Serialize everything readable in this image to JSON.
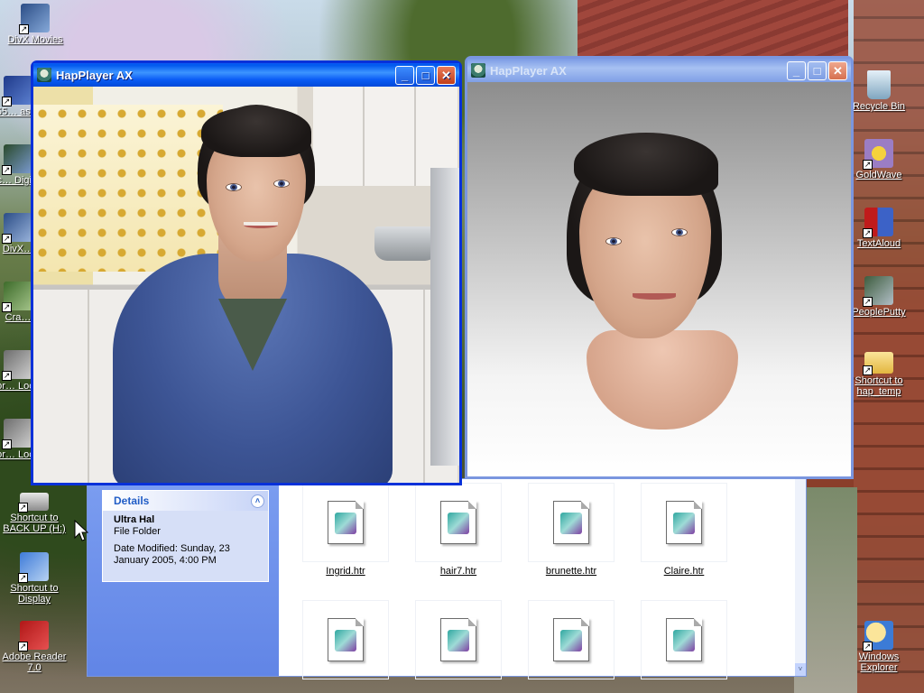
{
  "desktop": {
    "left_icons": [
      {
        "label": "DivX Movies",
        "icon": "divx-icon"
      },
      {
        "label": "555… ass…",
        "icon": "document-icon"
      },
      {
        "label": "Mic… Digita…",
        "icon": "app-icon"
      },
      {
        "label": "DivX…",
        "icon": "divx-icon"
      },
      {
        "label": "Cra…",
        "icon": "app-icon"
      },
      {
        "label": "Shor… Local…",
        "icon": "shortcut-icon"
      },
      {
        "label": "Shor… Local…",
        "icon": "shortcut-icon"
      },
      {
        "label": "Shortcut to BACK UP (H:)",
        "icon": "drive-icon"
      },
      {
        "label": "Shortcut to Display",
        "icon": "display-icon"
      },
      {
        "label": "Adobe Reader 7.0",
        "icon": "pdf-icon"
      }
    ],
    "right_icons": [
      {
        "label": "Recycle Bin",
        "icon": "recycle-bin-icon"
      },
      {
        "label": "GoldWave",
        "icon": "goldwave-icon"
      },
      {
        "label": "TextAloud",
        "icon": "textaloud-icon"
      },
      {
        "label": "PeoplePutty",
        "icon": "peopleputty-icon"
      },
      {
        "label": "Shortcut to hap_temp",
        "icon": "folder-icon"
      },
      {
        "label": "Windows Explorer",
        "icon": "explorer-icon"
      }
    ]
  },
  "window_left": {
    "title": "HapPlayer AX",
    "state": "active",
    "scene": "kitchen"
  },
  "window_right": {
    "title": "HapPlayer AX",
    "state": "inactive",
    "scene": "gradient-studio"
  },
  "window_buttons": {
    "minimize": "_",
    "maximize": "□",
    "close": "✕"
  },
  "explorer": {
    "details": {
      "header": "Details",
      "collapse_glyph": "˄",
      "name": "Ultra Hal",
      "type": "File Folder",
      "modified": "Date Modified: Sunday, 23 January 2005, 4:00 PM"
    },
    "files": [
      {
        "name": "Ingrid.htr"
      },
      {
        "name": "hair7.htr"
      },
      {
        "name": "brunette.htr"
      },
      {
        "name": "Claire.htr"
      },
      {
        "name": ""
      },
      {
        "name": ""
      },
      {
        "name": ""
      },
      {
        "name": ""
      }
    ],
    "scroll_glyph": "˅"
  },
  "colors": {
    "xp_title_active": "#0a5bf6",
    "xp_title_inactive": "#7b9be4",
    "task_pane": "#6185e6",
    "details_text": "#215dc6"
  }
}
